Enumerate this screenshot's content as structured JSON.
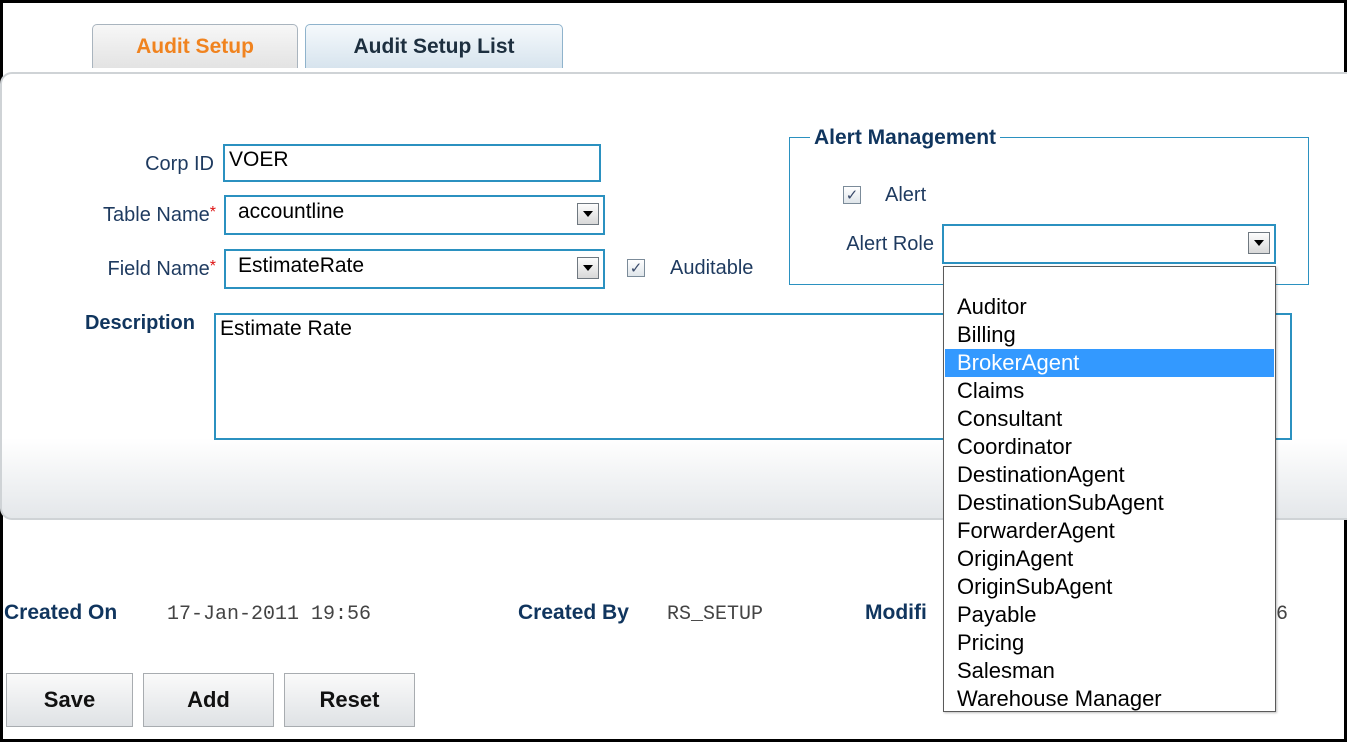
{
  "tabs": {
    "audit_setup": "Audit Setup",
    "audit_setup_list": "Audit Setup List"
  },
  "form": {
    "corp_id_label": "Corp ID",
    "corp_id_value": "VOER",
    "table_name_label": "Table Name",
    "table_name_value": "accountline",
    "field_name_label": "Field Name",
    "field_name_value": "EstimateRate",
    "required_mark": "*",
    "auditable_label": "Auditable",
    "auditable_checked": true,
    "description_label": "Description",
    "description_value": "Estimate Rate"
  },
  "alert_management": {
    "legend": "Alert Management",
    "alert_label": "Alert",
    "alert_checked": true,
    "alert_role_label": "Alert Role",
    "alert_role_value": "",
    "options": [
      "Auditor",
      "Billing",
      "BrokerAgent",
      "Claims",
      "Consultant",
      "Coordinator",
      "DestinationAgent",
      "DestinationSubAgent",
      "ForwarderAgent",
      "OriginAgent",
      "OriginSubAgent",
      "Payable",
      "Pricing",
      "Salesman",
      "Warehouse Manager"
    ],
    "highlighted_option": "BrokerAgent"
  },
  "footer": {
    "created_on_label": "Created On",
    "created_on_value": "17-Jan-2011 19:56",
    "created_by_label": "Created By",
    "created_by_value": "RS_SETUP",
    "modified_label_visible": "Modifi",
    "modified_value_visible": "6"
  },
  "buttons": {
    "save": "Save",
    "add": "Add",
    "reset": "Reset"
  },
  "colors": {
    "active_tab_text": "#f0831f",
    "field_border": "#2b91c0",
    "label_text": "#10355e",
    "dropdown_highlight": "#3399ff"
  }
}
